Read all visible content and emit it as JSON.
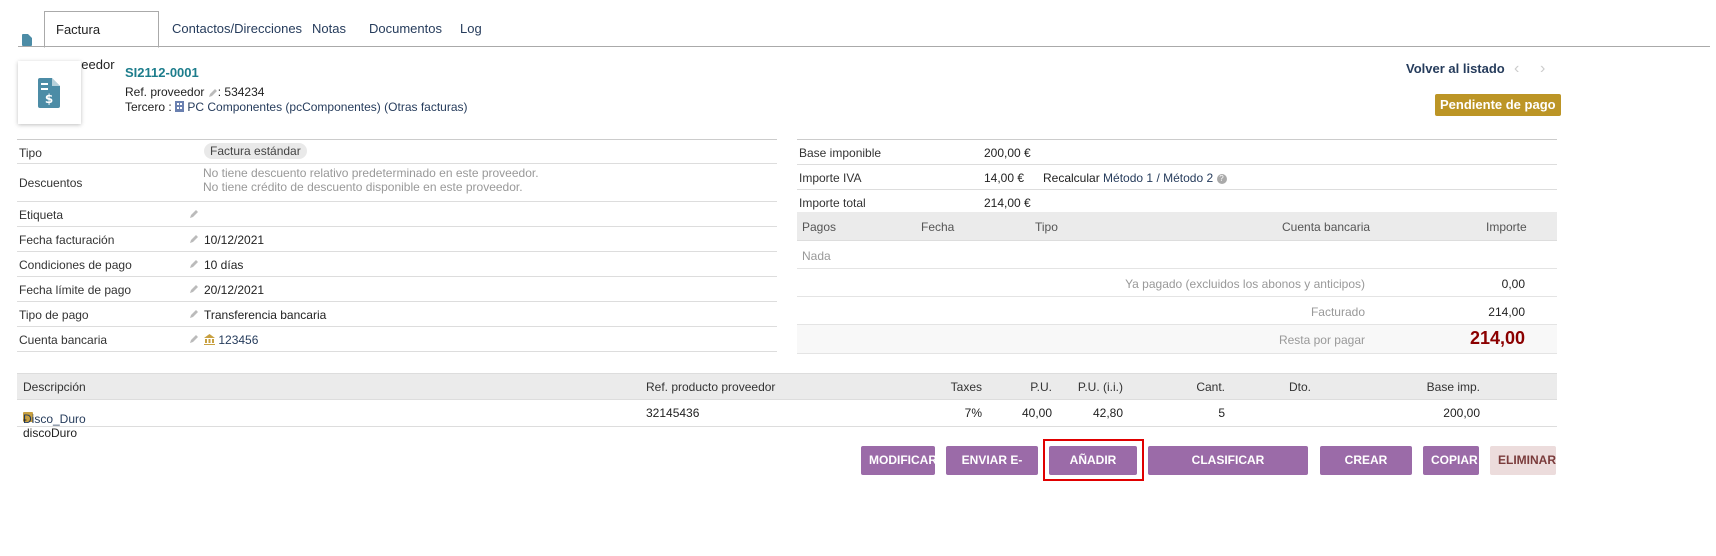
{
  "tabs": {
    "items": [
      {
        "label": "Factura proveedor"
      },
      {
        "label": "Contactos/Direcciones"
      },
      {
        "label": "Notas"
      },
      {
        "label": "Documentos"
      },
      {
        "label": "Log"
      }
    ]
  },
  "header": {
    "ref": "SI2112-0001",
    "ref_supplier_label": "Ref. proveedor",
    "ref_supplier_value": ": 534234",
    "tercero_label": "Tercero :",
    "tercero_name": "PC Componentes (pcComponentes)",
    "other_invoices": "(Otras facturas)",
    "back_label": "Volver al listado",
    "prev_arrow": "‹",
    "next_arrow": "›",
    "status": "Pendiente de pago"
  },
  "fields": {
    "tipo_label": "Tipo",
    "tipo_value": "Factura estándar",
    "descuentos_label": "Descuentos",
    "descuentos_line1": "No tiene descuento relativo predeterminado en este proveedor.",
    "descuentos_line2": "No tiene crédito de descuento disponible en este proveedor.",
    "etiqueta_label": "Etiqueta",
    "fecha_label": "Fecha facturación",
    "fecha_value": "10/12/2021",
    "condiciones_label": "Condiciones de pago",
    "condiciones_value": "10 días",
    "limite_label": "Fecha límite de pago",
    "limite_value": "20/12/2021",
    "tipo_pago_label": "Tipo de pago",
    "tipo_pago_value": "Transferencia bancaria",
    "cuenta_label": "Cuenta bancaria",
    "cuenta_value": "123456"
  },
  "totals": {
    "base_label": "Base imponible",
    "base_value": "200,00 €",
    "iva_label": "Importe IVA",
    "iva_value": "14,00 €",
    "recalcular_label": "Recalcular",
    "metodo1": "Método 1",
    "metodo2": "Método 2",
    "slash": "/",
    "total_label": "Importe total",
    "total_value": "214,00 €"
  },
  "payments": {
    "headers": {
      "pagos": "Pagos",
      "fecha": "Fecha",
      "tipo": "Tipo",
      "cuenta": "Cuenta bancaria",
      "importe": "Importe"
    },
    "empty": "Nada",
    "ya_pagado_label": "Ya pagado (excluidos los abonos y anticipos)",
    "ya_pagado_value": "0,00",
    "facturado_label": "Facturado",
    "facturado_value": "214,00",
    "resta_label": "Resta por pagar",
    "resta_value": "214,00"
  },
  "lines": {
    "headers": {
      "descripcion": "Descripción",
      "ref_producto": "Ref. producto proveedor",
      "taxes": "Taxes",
      "pu": "P.U.",
      "pu_ii": "P.U. (i.i.)",
      "cant": "Cant.",
      "dto": "Dto.",
      "base": "Base imp."
    },
    "rows": [
      {
        "product": "Disco_Duro",
        "desc": " - discoDuro",
        "ref": "32145436",
        "tax": "7%",
        "pu": "40,00",
        "pu_ii": "42,80",
        "cant": "5",
        "base": "200,00"
      }
    ]
  },
  "actions": {
    "modificar": "MODIFICAR",
    "enviar": "ENVIAR E-MAIL",
    "anadir": "AÑADIR PAGO",
    "clasificar": "CLASIFICAR 'ABANDONADO'",
    "abono": "CREAR ABONO",
    "copiar": "COPIAR",
    "eliminar": "ELIMINAR"
  },
  "colors": {
    "accent_button": "#9b6ba8",
    "status_badge": "#bc9526",
    "ref_link": "#1d7d8c",
    "remaining": "#8b0000",
    "highlight_box": "#e00000"
  }
}
